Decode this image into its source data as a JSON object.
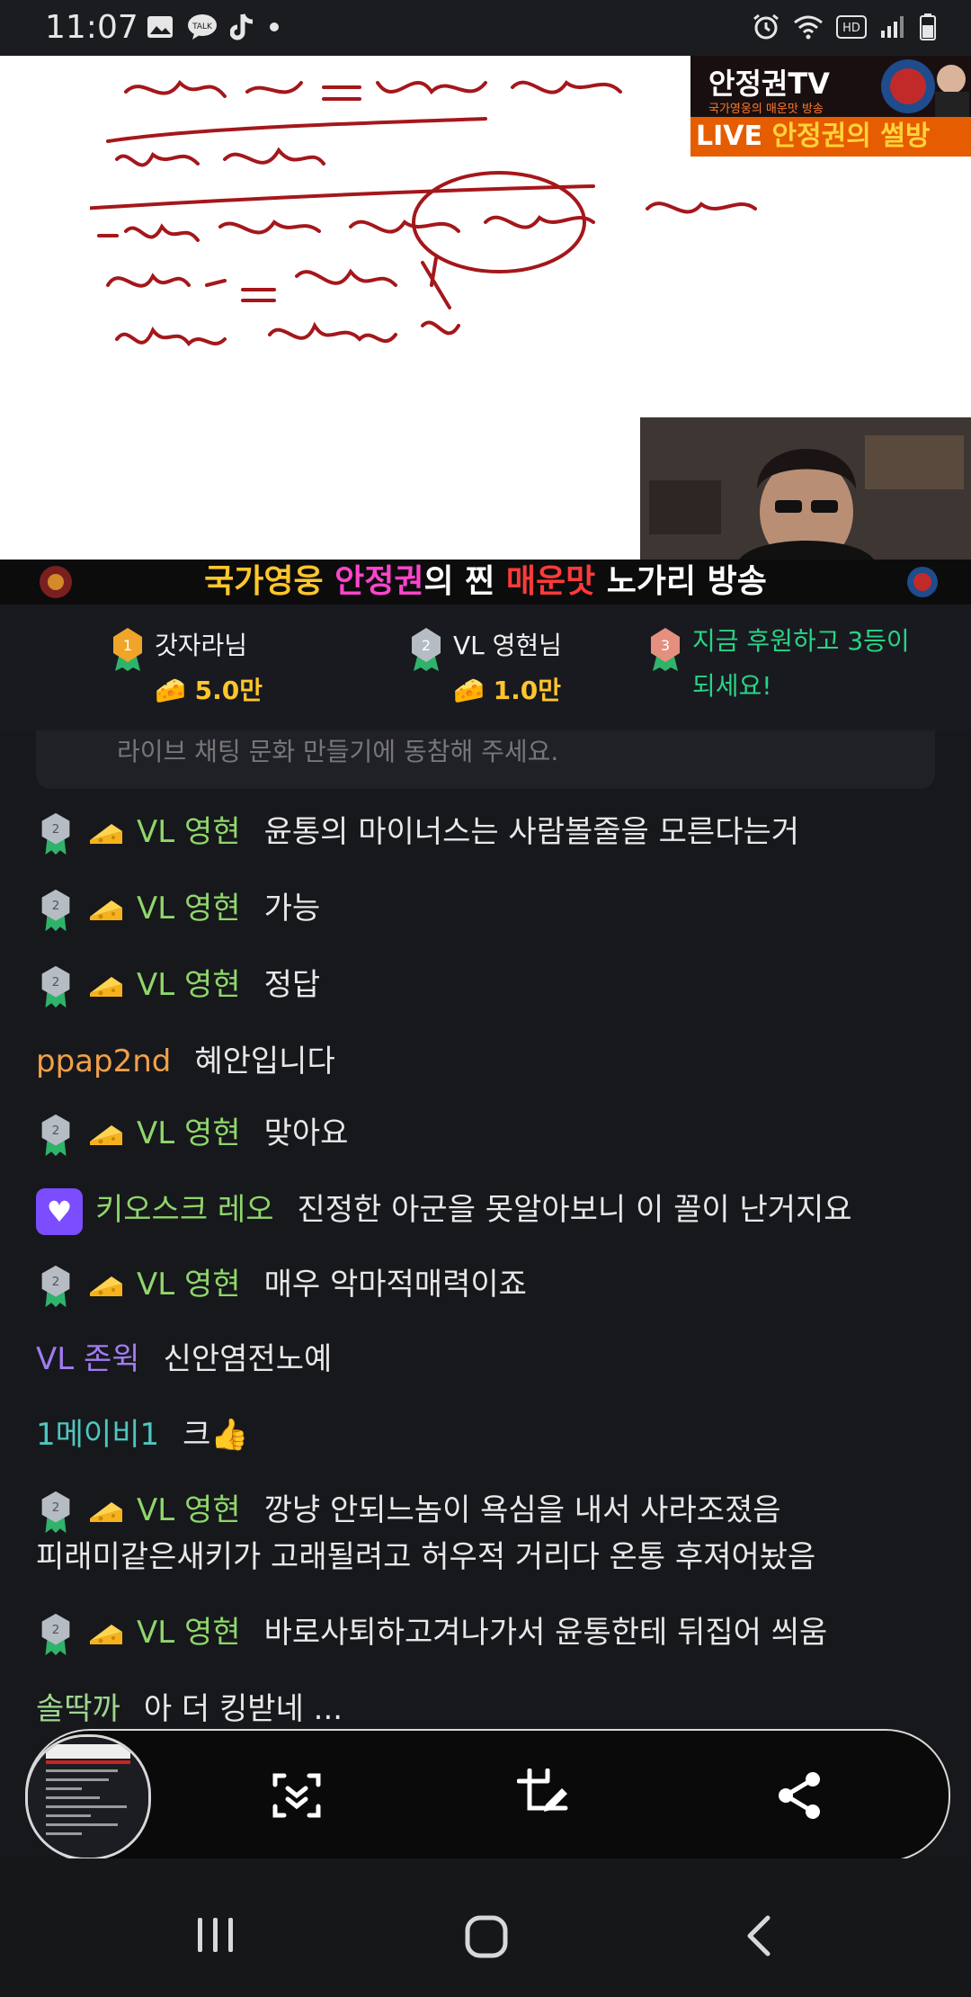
{
  "status_bar": {
    "time": "11:07",
    "left_icons": [
      "image-icon",
      "talk-icon",
      "tiktok-icon",
      "dot-icon"
    ],
    "right_icons": [
      "alarm-icon",
      "wifi-icon",
      "hd-icon",
      "signal-icon",
      "battery-icon"
    ]
  },
  "video": {
    "logo_title": "안정권TV",
    "logo_subtitle": "국가영웅의 매운맛 방송",
    "live_prefix": "LIVE ",
    "live_name": "안정권의 썰방"
  },
  "banner": {
    "part1": "국가영웅 ",
    "part2": "안정권",
    "part3": "의 찐 ",
    "part4": "매운맛",
    "part5": " 노가리 방송"
  },
  "donors": [
    {
      "rank": "1",
      "name": "갓자라님",
      "amount": "5.0만"
    },
    {
      "rank": "2",
      "name": "VL 영현님",
      "amount": "1.0만"
    },
    {
      "rank": "3",
      "promo_line1": "지금 후원하고 3등이",
      "promo_line2": "되세요!"
    }
  ],
  "notice_text": "라이브 채팅 문화 만들기에 동참해 주세요.",
  "messages": [
    {
      "user": "VL 영현",
      "text": "윤통의 마이너스는 사람볼줄을 모른다는거"
    },
    {
      "user": "VL 영현",
      "text": "가능"
    },
    {
      "user": "VL 영현",
      "text": "정답"
    },
    {
      "user": "ppap2nd",
      "text": "혜안입니다"
    },
    {
      "user": "VL 영현",
      "text": "맞아요"
    },
    {
      "user": "키오스크 레오",
      "text": "진정한 아군을 못알아보니 이 꼴이 난거지요"
    },
    {
      "user": "VL 영현",
      "text": "매우 악마적매력이죠"
    },
    {
      "user": "VL 존윅",
      "text": "신안염전노예"
    },
    {
      "user": "1메이비1",
      "text": "크👍"
    },
    {
      "user": "VL 영현",
      "text": "깡냥 안되느놈이 욕심을 내서 사라조졌음",
      "text2": "피래미같은새키가 고래될려고 허우적 거리다 온통  후져어놨음"
    },
    {
      "user": "VL 영현",
      "text": "바로사퇴하고겨나가서 윤통한테 뒤집어 씌움"
    },
    {
      "user": "솔딱까",
      "text": "아 더 킹받네 ..."
    }
  ],
  "toolbar": {
    "buttons": [
      "scroll-capture-icon",
      "crop-edit-icon",
      "share-icon"
    ]
  },
  "navbar": {
    "buttons": [
      "recent-apps-icon",
      "home-icon",
      "back-icon"
    ]
  }
}
